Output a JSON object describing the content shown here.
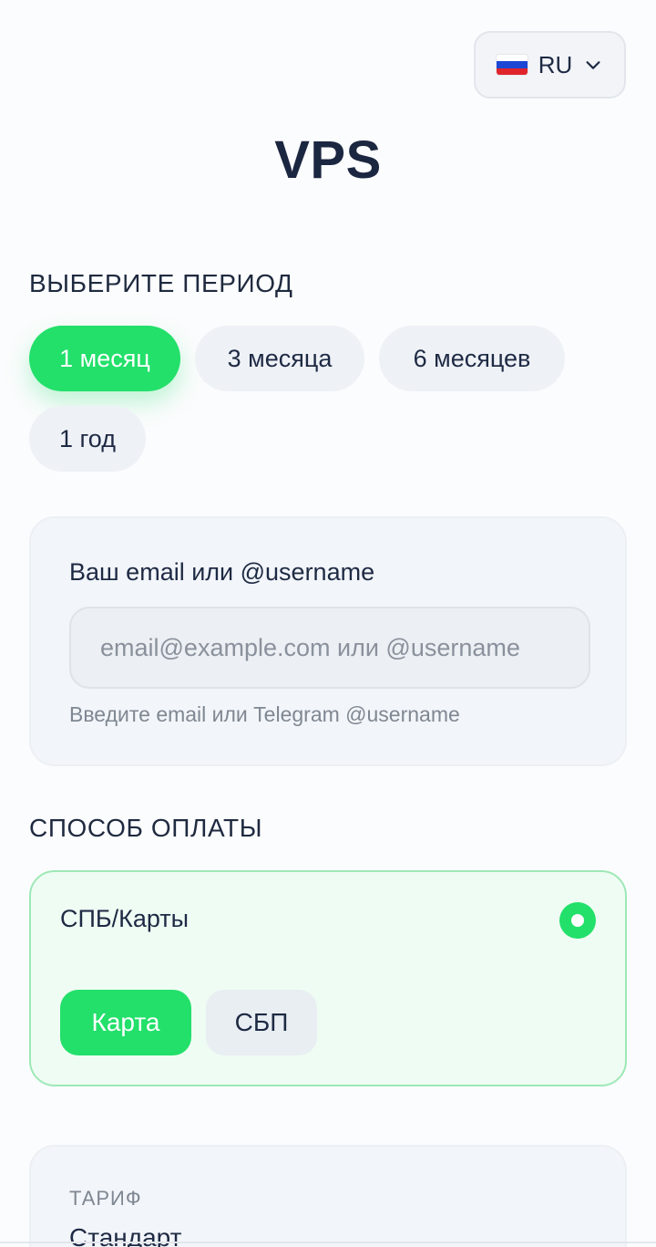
{
  "header": {
    "language": {
      "code": "RU",
      "flag_icon": "russia-flag-icon",
      "chevron_icon": "chevron-down-icon"
    },
    "title": "VPS"
  },
  "period": {
    "label": "ВЫБЕРИТЕ ПЕРИОД",
    "options": [
      "1 месяц",
      "3 месяца",
      "6 месяцев",
      "1 год"
    ],
    "selected": "1 месяц"
  },
  "contact": {
    "label": "Ваш email или @username",
    "value": "",
    "placeholder": "email@example.com или @username",
    "hint": "Введите email или Telegram @username"
  },
  "payment": {
    "label": "СПОСОБ ОПЛАТЫ",
    "method": "СПБ/Карты",
    "method_selected": true,
    "sub_options": [
      "Карта",
      "СБП"
    ],
    "sub_selected": "Карта"
  },
  "summary": {
    "tariff_label": "ТАРИФ",
    "tariff_value": "Стандарт"
  },
  "colors": {
    "accent": "#22e06a",
    "text": "#1e2a44",
    "muted": "#7f8792",
    "chip_bg": "#eef1f6"
  }
}
